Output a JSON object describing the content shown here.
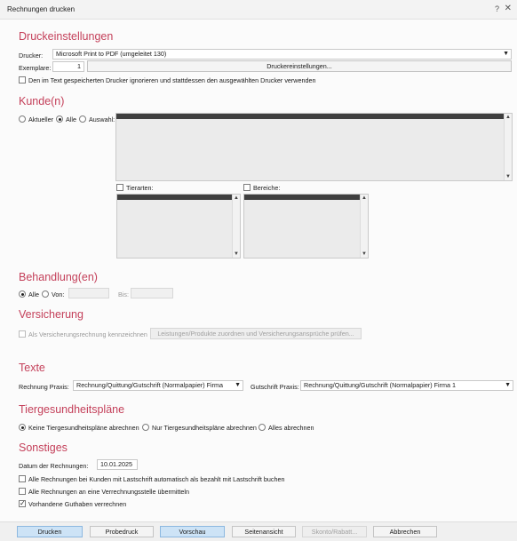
{
  "window": {
    "title": "Rechnungen drucken",
    "help": "?",
    "close": "✕"
  },
  "druck": {
    "heading": "Druckeinstellungen",
    "drucker_label": "Drucker:",
    "drucker_value": "Microsoft Print to PDF (umgeleitet 130)",
    "exemplare_label": "Exemplare:",
    "exemplare_value": "1",
    "druckereinstellungen_button": "Druckereinstellungen...",
    "ignore_checkbox_label": "Den im Text gespeicherten Drucker ignorieren und stattdessen den ausgewählten Drucker verwenden",
    "ignore_checked": false
  },
  "kunde": {
    "heading": "Kunde(n)",
    "radio_aktueller": "Aktueller",
    "radio_alle": "Alle",
    "radio_auswahl": "Auswahl:",
    "selected_radio": "Alle",
    "tierarten_label": "Tierarten:",
    "bereiche_label": "Bereiche:"
  },
  "behandlung": {
    "heading": "Behandlung(en)",
    "radio_alle": "Alle",
    "radio_von": "Von:",
    "bis_label": "Bis:",
    "selected_radio": "Alle"
  },
  "versicherung": {
    "heading": "Versicherung",
    "checkbox_label": "Als Versicherungsrechnung kennzeichnen",
    "zuordnen_button": "Leistungen/Produkte zuordnen und Versicherungsansprüche prüfen..."
  },
  "texte": {
    "heading": "Texte",
    "rechnung_label": "Rechnung Praxis:",
    "rechnung_value": "Rechnung/Quittung/Gutschrift (Normalpapier) Firma",
    "gutschrift_label": "Gutschrift Praxis:",
    "gutschrift_value": "Rechnung/Quittung/Gutschrift (Normalpapier) Firma 1"
  },
  "tiergesundheit": {
    "heading": "Tiergesundheitspläne",
    "radio_keine": "Keine Tiergesundheitspläne abrechnen",
    "radio_nur": "Nur Tiergesundheitspläne abrechnen",
    "radio_alles": "Alles abrechnen",
    "selected_radio": "Keine Tiergesundheitspläne abrechnen"
  },
  "sonstiges": {
    "heading": "Sonstiges",
    "datum_label": "Datum der Rechnungen:",
    "datum_value": "10.01.2025",
    "lastschrift_label": "Alle Rechnungen bei Kunden mit Lastschrift automatisch als bezahlt mit Lastschrift buchen",
    "lastschrift_checked": false,
    "verrechnung_label": "Alle Rechnungen an eine Verrechnungsstelle übermitteln",
    "verrechnung_checked": false,
    "guthaben_label": "Vorhandene Guthaben verrechnen",
    "guthaben_checked": true
  },
  "footer": {
    "drucken": "Drucken",
    "probedruck": "Probedruck",
    "vorschau": "Vorschau",
    "seitenansicht": "Seitenansicht",
    "skonto": "Skonto/Rabatt...",
    "abbrechen": "Abbrechen"
  },
  "colors": {
    "heading": "#c4405a",
    "primary_button": "#cde3f6",
    "list_selection": "#3f3f3f"
  }
}
